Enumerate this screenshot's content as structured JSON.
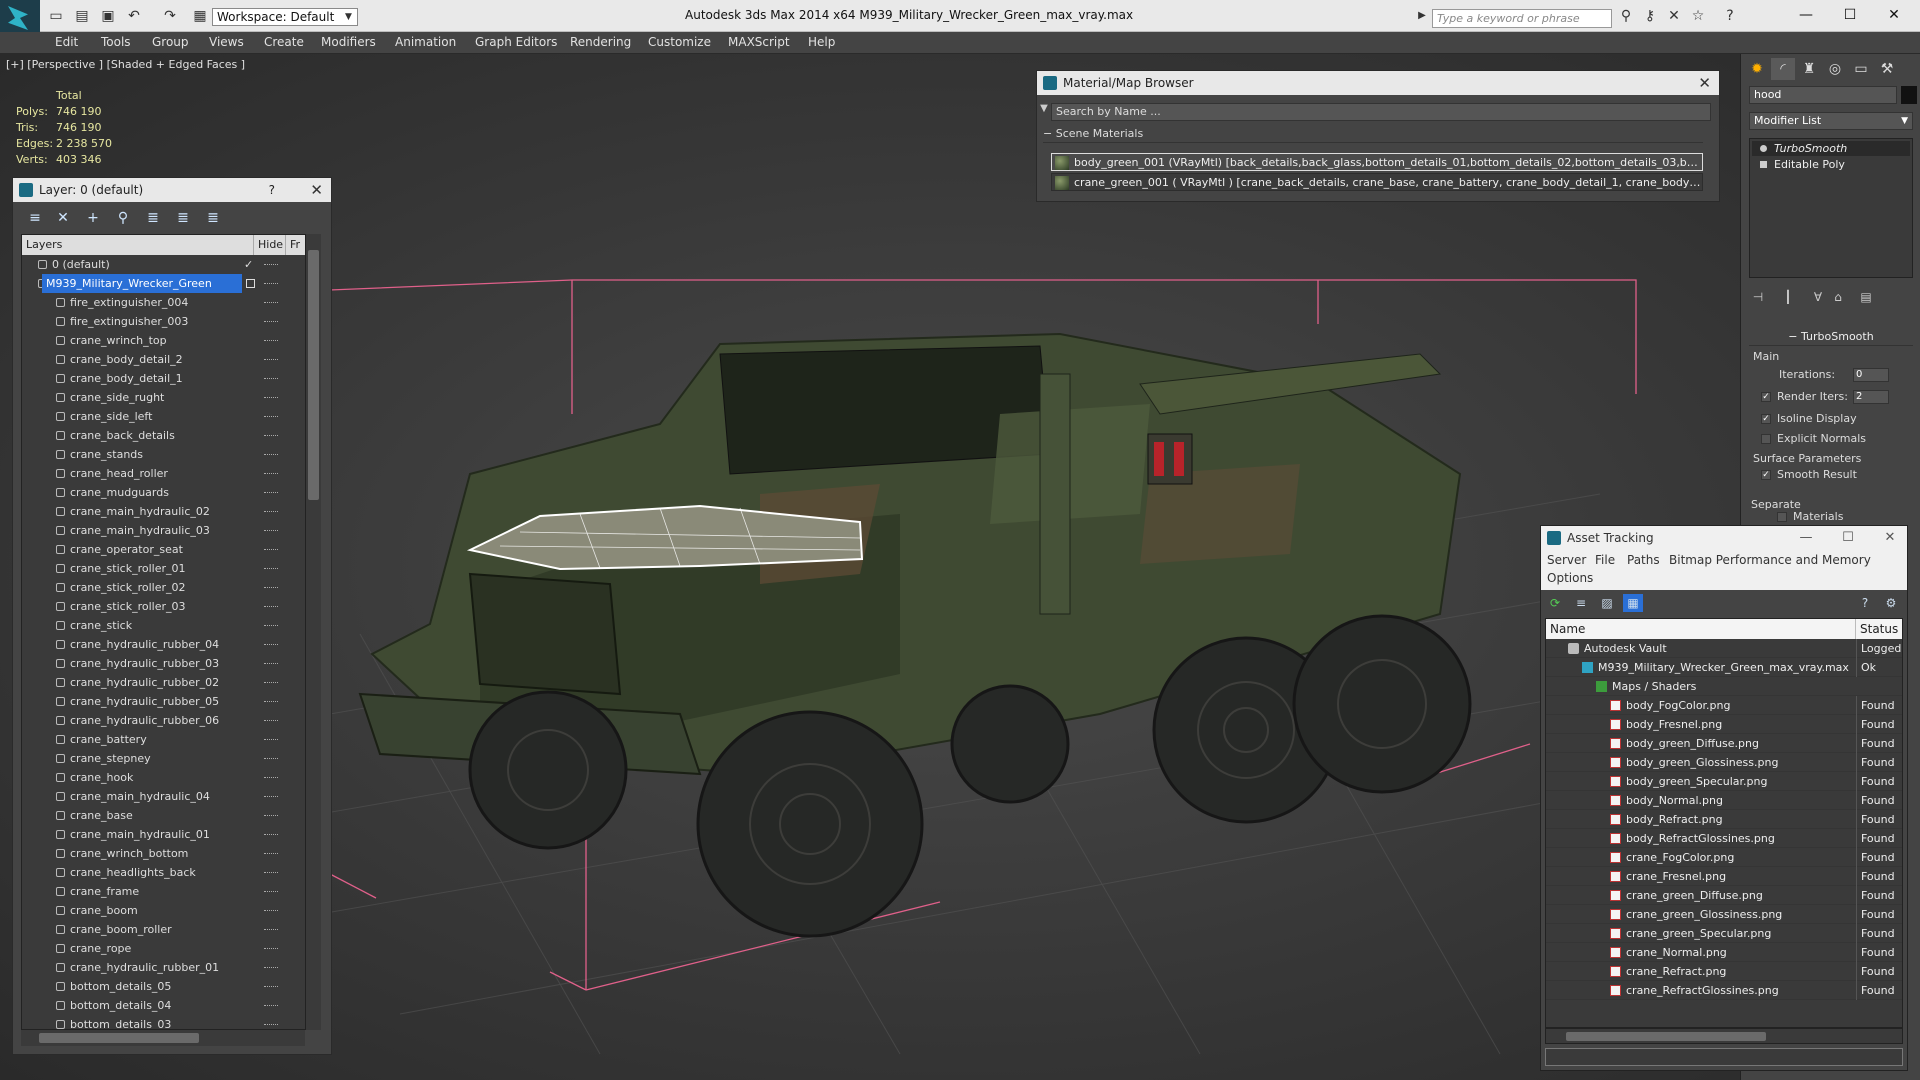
{
  "titlebar": {
    "workspace": "Workspace: Default",
    "app_title": "Autodesk 3ds Max  2014 x64      M939_Military_Wrecker_Green_max_vray.max",
    "search_placeholder": "Type a keyword or phrase"
  },
  "menu": [
    "Edit",
    "Tools",
    "Group",
    "Views",
    "Create",
    "Modifiers",
    "Animation",
    "Graph Editors",
    "Rendering",
    "Customize",
    "MAXScript",
    "Help"
  ],
  "viewport": {
    "label": "[+] [Perspective ] [Shaded + Edged Faces ]",
    "stats": {
      "header": "Total",
      "rows": [
        {
          "label": "Polys:",
          "value": "746 190"
        },
        {
          "label": "Tris:",
          "value": "746 190"
        },
        {
          "label": "Edges:",
          "value": "2 238 570"
        },
        {
          "label": "Verts:",
          "value": "403 346"
        }
      ]
    }
  },
  "layer_panel": {
    "title": "Layer: 0 (default)",
    "help": "?",
    "columns": {
      "layers": "Layers",
      "hide": "Hide",
      "freeze": "Fr"
    },
    "rows": [
      {
        "name": "0 (default)",
        "kind": "layer",
        "checked": true
      },
      {
        "name": "M939_Military_Wrecker_Green",
        "kind": "layer",
        "selected": true
      },
      {
        "name": "fire_extinguisher_004"
      },
      {
        "name": "fire_extinguisher_003"
      },
      {
        "name": "crane_wrinch_top"
      },
      {
        "name": "crane_body_detail_2"
      },
      {
        "name": "crane_body_detail_1"
      },
      {
        "name": "crane_side_rught"
      },
      {
        "name": "crane_side_left"
      },
      {
        "name": "crane_back_details"
      },
      {
        "name": "crane_stands"
      },
      {
        "name": "crane_head_roller"
      },
      {
        "name": "crane_mudguards"
      },
      {
        "name": "crane_main_hydraulic_02"
      },
      {
        "name": "crane_main_hydraulic_03"
      },
      {
        "name": "crane_operator_seat"
      },
      {
        "name": "crane_stick_roller_01"
      },
      {
        "name": "crane_stick_roller_02"
      },
      {
        "name": "crane_stick_roller_03"
      },
      {
        "name": "crane_stick"
      },
      {
        "name": "crane_hydraulic_rubber_04"
      },
      {
        "name": "crane_hydraulic_rubber_03"
      },
      {
        "name": "crane_hydraulic_rubber_02"
      },
      {
        "name": "crane_hydraulic_rubber_05"
      },
      {
        "name": "crane_hydraulic_rubber_06"
      },
      {
        "name": "crane_battery"
      },
      {
        "name": "crane_stepney"
      },
      {
        "name": "crane_hook"
      },
      {
        "name": "crane_main_hydraulic_04"
      },
      {
        "name": "crane_base"
      },
      {
        "name": "crane_main_hydraulic_01"
      },
      {
        "name": "crane_wrinch_bottom"
      },
      {
        "name": "crane_headlights_back"
      },
      {
        "name": "crane_frame"
      },
      {
        "name": "crane_boom"
      },
      {
        "name": "crane_boom_roller"
      },
      {
        "name": "crane_rope"
      },
      {
        "name": "crane_hydraulic_rubber_01"
      },
      {
        "name": "bottom_details_05"
      },
      {
        "name": "bottom_details_04"
      },
      {
        "name": "bottom_details_03"
      }
    ]
  },
  "material_browser": {
    "title": "Material/Map Browser",
    "search": "Search by Name ...",
    "section": "Scene Materials",
    "rows": [
      "body_green_001 (VRayMtl) [back_details,back_glass,bottom_details_01,bottom_details_02,bottom_details_03,botto...",
      "crane_green_001 ( VRayMtl ) [crane_back_details, crane_base, crane_battery, crane_body_detail_1, crane_body_detail_..."
    ]
  },
  "command_panel": {
    "object_name": "hood",
    "modifier_list": "Modifier List",
    "stack": [
      "TurboSmooth",
      "Editable Poly"
    ],
    "turbosmooth": {
      "title": "TurboSmooth",
      "main": "Main",
      "iterations_label": "Iterations:",
      "iterations": "0",
      "render_iters_label": "Render Iters:",
      "render_iters": "2",
      "isoline": "Isoline Display",
      "explicit": "Explicit Normals",
      "surface": "Surface Parameters",
      "smooth": "Smooth Result",
      "separate": "Separate",
      "materials": "Materials"
    }
  },
  "asset_tracking": {
    "title": "Asset Tracking",
    "menu": [
      "Server",
      "File",
      "Paths",
      "Bitmap Performance and Memory",
      "Options"
    ],
    "columns": {
      "name": "Name",
      "status": "Status"
    },
    "rows": [
      {
        "name": "Autodesk Vault",
        "status": "Logged O",
        "level": 0,
        "icon": "vault"
      },
      {
        "name": "M939_Military_Wrecker_Green_max_vray.max",
        "status": "Ok",
        "level": 1,
        "icon": "max"
      },
      {
        "name": "Maps / Shaders",
        "status": "",
        "level": 2,
        "icon": "folder"
      },
      {
        "name": "body_FogColor.png",
        "status": "Found",
        "level": 3,
        "icon": "png"
      },
      {
        "name": "body_Fresnel.png",
        "status": "Found",
        "level": 3,
        "icon": "png"
      },
      {
        "name": "body_green_Diffuse.png",
        "status": "Found",
        "level": 3,
        "icon": "png"
      },
      {
        "name": "body_green_Glossiness.png",
        "status": "Found",
        "level": 3,
        "icon": "png"
      },
      {
        "name": "body_green_Specular.png",
        "status": "Found",
        "level": 3,
        "icon": "png"
      },
      {
        "name": "body_Normal.png",
        "status": "Found",
        "level": 3,
        "icon": "png"
      },
      {
        "name": "body_Refract.png",
        "status": "Found",
        "level": 3,
        "icon": "png"
      },
      {
        "name": "body_RefractGlossines.png",
        "status": "Found",
        "level": 3,
        "icon": "png"
      },
      {
        "name": "crane_FogColor.png",
        "status": "Found",
        "level": 3,
        "icon": "png"
      },
      {
        "name": "crane_Fresnel.png",
        "status": "Found",
        "level": 3,
        "icon": "png"
      },
      {
        "name": "crane_green_Diffuse.png",
        "status": "Found",
        "level": 3,
        "icon": "png"
      },
      {
        "name": "crane_green_Glossiness.png",
        "status": "Found",
        "level": 3,
        "icon": "png"
      },
      {
        "name": "crane_green_Specular.png",
        "status": "Found",
        "level": 3,
        "icon": "png"
      },
      {
        "name": "crane_Normal.png",
        "status": "Found",
        "level": 3,
        "icon": "png"
      },
      {
        "name": "crane_Refract.png",
        "status": "Found",
        "level": 3,
        "icon": "png"
      },
      {
        "name": "crane_RefractGlossines.png",
        "status": "Found",
        "level": 3,
        "icon": "png"
      }
    ]
  },
  "colors": {
    "accent": "#2a6fd6",
    "selection_box": "#e0608a",
    "truck_green": "#3f4a32"
  }
}
